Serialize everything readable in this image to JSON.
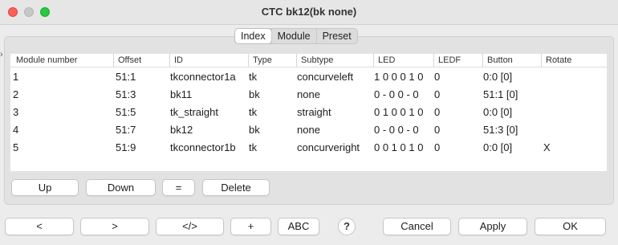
{
  "window": {
    "title": "CTC bk12(bk none)"
  },
  "edge_mark": "›",
  "tabs": [
    {
      "label": "Index",
      "active": true
    },
    {
      "label": "Module",
      "active": false
    },
    {
      "label": "Preset",
      "active": false
    }
  ],
  "table": {
    "columns": [
      "Module number",
      "Offset",
      "ID",
      "Type",
      "Subtype",
      "LED",
      "LEDF",
      "Button",
      "Rotate"
    ],
    "rows": [
      [
        "1",
        "51:1",
        "tkconnector1a",
        "tk",
        "concurveleft",
        "1 0 0 0 1 0",
        "0",
        "0:0 [0]",
        ""
      ],
      [
        "2",
        "51:3",
        "bk11",
        "bk",
        "none",
        "0 - 0 0 - 0",
        "0",
        "51:1 [0]",
        ""
      ],
      [
        "3",
        "51:5",
        "tk_straight",
        "tk",
        "straight",
        "0 1 0 0 1 0",
        "0",
        "0:0 [0]",
        ""
      ],
      [
        "4",
        "51:7",
        "bk12",
        "bk",
        "none",
        "0 - 0 0 - 0",
        "0",
        "51:3 [0]",
        ""
      ],
      [
        "5",
        "51:9",
        "tkconnector1b",
        "tk",
        "concurveright",
        "0 0 1 0 1 0",
        "0",
        "0:0 [0]",
        "X"
      ]
    ]
  },
  "panel_buttons": {
    "up": "Up",
    "down": "Down",
    "equals": "=",
    "delete": "Delete"
  },
  "bottom_buttons": {
    "prev": "<",
    "next": ">",
    "code": "</>",
    "plus": "+",
    "abc": "ABC",
    "help": "?",
    "cancel": "Cancel",
    "apply": "Apply",
    "ok": "OK"
  }
}
